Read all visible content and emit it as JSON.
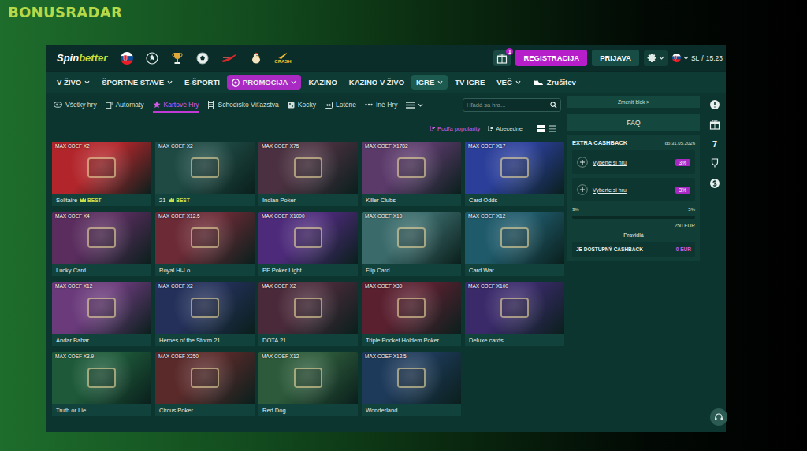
{
  "watermark": "BONUSRADAR",
  "header": {
    "logo": [
      "Spin",
      "better"
    ],
    "icons": [
      {
        "kind": "flag",
        "label": null
      },
      {
        "kind": "starball",
        "label": null
      },
      {
        "kind": "cup",
        "label": null
      },
      {
        "kind": "ball",
        "label": null
      },
      {
        "kind": "swoosh",
        "label": null
      },
      {
        "kind": "chicken",
        "label": null
      },
      {
        "kind": "crash",
        "label": "CRASH"
      }
    ],
    "gift_badge": "1",
    "register": "REGISTRACIJA",
    "login": "PRIJAVA",
    "lang": "SL",
    "separator": "/",
    "time": "15:23"
  },
  "nav": [
    {
      "label": "V ŽIVO",
      "dropdown": true,
      "selected": false,
      "kind": "link"
    },
    {
      "label": "ŠPORTNE STAVE",
      "dropdown": true,
      "selected": false,
      "kind": "link"
    },
    {
      "label": "E-ŠPORTI",
      "dropdown": false,
      "selected": false,
      "kind": "link"
    },
    {
      "label": "PROMOCIJA",
      "dropdown": true,
      "selected": false,
      "kind": "promo"
    },
    {
      "label": "KAZINO",
      "dropdown": false,
      "selected": false,
      "kind": "link"
    },
    {
      "label": "KAZINO V ŽIVO",
      "dropdown": false,
      "selected": false,
      "kind": "link"
    },
    {
      "label": "IGRE",
      "dropdown": true,
      "selected": true,
      "kind": "link"
    },
    {
      "label": "TV IGRE",
      "dropdown": false,
      "selected": false,
      "kind": "link"
    },
    {
      "label": "VEČ",
      "dropdown": true,
      "selected": false,
      "kind": "link"
    },
    {
      "label": "Zrušitev",
      "dropdown": false,
      "selected": false,
      "kind": "cancel"
    }
  ],
  "categories": [
    {
      "label": "Všetky hry",
      "kind": "pad",
      "selected": false
    },
    {
      "label": "Automaty",
      "kind": "slot",
      "selected": false
    },
    {
      "label": "Kartové Hry",
      "kind": "card",
      "selected": true
    },
    {
      "label": "Schodisko Víťazstva",
      "kind": "ladder",
      "selected": false
    },
    {
      "label": "Kocky",
      "kind": "dice",
      "selected": false
    },
    {
      "label": "Lotérie",
      "kind": "lotto",
      "selected": false
    },
    {
      "label": "Iné Hry",
      "kind": "dots",
      "selected": false
    },
    {
      "label": "",
      "kind": "menu",
      "selected": false
    }
  ],
  "search": {
    "placeholder": "Hľadá sa hra..."
  },
  "sort": [
    {
      "label": "Podľa popularity",
      "selected": true
    },
    {
      "label": "Abecedne",
      "selected": false
    }
  ],
  "views": [
    {
      "kind": "grid",
      "selected": true
    },
    {
      "kind": "list",
      "selected": false
    }
  ],
  "games": [
    {
      "name": "Solitaire",
      "coef": "MAX COEF X2",
      "badge": "BEST",
      "color": "#b2262b"
    },
    {
      "name": "21",
      "coef": "MAX COEF X2",
      "badge": "BEST",
      "color": "#1f4a44"
    },
    {
      "name": "Indian Poker",
      "coef": "MAX COEF X75",
      "badge": null,
      "color": "#4a3040"
    },
    {
      "name": "Killer Clubs",
      "coef": "MAX COEF X1782",
      "badge": null,
      "color": "#5b3a6a"
    },
    {
      "name": "Card Odds",
      "coef": "MAX COEF X17",
      "badge": null,
      "color": "#2b3f9a"
    },
    {
      "name": "Lucky Card",
      "coef": "MAX COEF X4",
      "badge": null,
      "color": "#5a2d5e"
    },
    {
      "name": "Royal Hi-Lo",
      "coef": "MAX COEF X12.5",
      "badge": null,
      "color": "#6b2a35"
    },
    {
      "name": "PF Poker Light",
      "coef": "MAX COEF X1000",
      "badge": null,
      "color": "#4d2a7a"
    },
    {
      "name": "Flip Card",
      "coef": "MAX COEF X10",
      "badge": null,
      "color": "#3a6a6a"
    },
    {
      "name": "Card War",
      "coef": "MAX COEF X12",
      "badge": null,
      "color": "#1f5a6a"
    },
    {
      "name": "Andar Bahar",
      "coef": "MAX COEF X12",
      "badge": null,
      "color": "#6a3a7a"
    },
    {
      "name": "Heroes of the Storm 21",
      "coef": "MAX COEF X2",
      "badge": null,
      "color": "#24305a"
    },
    {
      "name": "DOTA 21",
      "coef": "MAX COEF X2",
      "badge": null,
      "color": "#4a2a3a"
    },
    {
      "name": "Triple Pocket Holdem Poker",
      "coef": "MAX COEF X30",
      "badge": null,
      "color": "#5a2030"
    },
    {
      "name": "Deluxe cards",
      "coef": "MAX COEF X100",
      "badge": null,
      "color": "#3a2a6a"
    },
    {
      "name": "Truth or Lie",
      "coef": "MAX COEF X3.9",
      "badge": null,
      "color": "#1e5a3a"
    },
    {
      "name": "Circus Poker",
      "coef": "MAX COEF X250",
      "badge": null,
      "color": "#5a2a2a"
    },
    {
      "name": "Red Dog",
      "coef": "MAX COEF X12",
      "badge": null,
      "color": "#2d5a3a"
    },
    {
      "name": "Wonderland",
      "coef": "MAX COEF X12.5",
      "badge": null,
      "color": "#1e3a5a"
    }
  ],
  "sidebar": {
    "change_block": "Zmeniť blok >",
    "faq": "FAQ",
    "cashback": {
      "title": "EXTRA CASHBACK",
      "until": "do 31.05.2026",
      "slots": [
        {
          "label": "Vyberte si hru",
          "percent": "3%"
        },
        {
          "label": "Vyberte si hru",
          "percent": "3%"
        }
      ],
      "min": "3%",
      "max": "5%",
      "level": 0,
      "amount": "250 EUR",
      "rules": "Pravidlá",
      "available_label": "JE DOSTUPNÝ CASHBACK",
      "available_value": "0 EUR"
    }
  },
  "side_icons": [
    {
      "kind": "shield",
      "label": null
    },
    {
      "kind": "gift",
      "label": null
    },
    {
      "kind": "seven",
      "label": "7"
    },
    {
      "kind": "cup",
      "label": null
    },
    {
      "kind": "coin",
      "label": null
    }
  ]
}
